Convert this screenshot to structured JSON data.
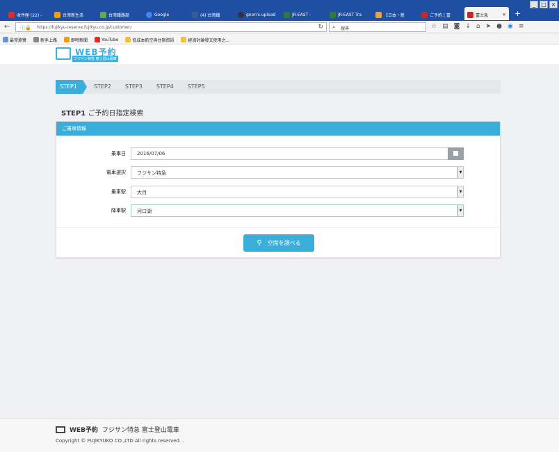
{
  "browser": {
    "tabs": [
      {
        "label": "收件匣 (22) -",
        "color": "#d93025"
      },
      {
        "label": "台灣新生活",
        "color": "#f39c12"
      },
      {
        "label": "台灣鐵路部",
        "color": "#6aa84f"
      },
      {
        "label": "Google",
        "color": "#4285f4"
      },
      {
        "label": "(4) 台灣鐵",
        "color": "#3b5998"
      },
      {
        "label": "gnon's upload",
        "color": "#333333"
      },
      {
        "label": "JR-EAST -",
        "color": "#2e7d32"
      },
      {
        "label": "JR-EAST Tra",
        "color": "#2e7d32"
      },
      {
        "label": "【日本・新",
        "color": "#e6a23c"
      },
      {
        "label": "ご予約 | 富",
        "color": "#c62828"
      },
      {
        "label": "富士急",
        "color": "#c62828"
      }
    ],
    "new_tab": "+",
    "url": "https://fujikyu-reserve.fujikyu.co.jp/customer/",
    "search_placeholder": "搜尋",
    "bookmarks": [
      {
        "label": "最常瀏覽",
        "color": "#6b8fd6"
      },
      {
        "label": "新手上路",
        "color": "#888888"
      },
      {
        "label": "即時新聞",
        "color": "#f39c12"
      },
      {
        "label": "YouTube",
        "color": "#e52d27"
      },
      {
        "label": "低成本航空與住宿資訊",
        "color": "#f1c232"
      },
      {
        "label": "經濟討論發文使用之...",
        "color": "#f1c232"
      }
    ]
  },
  "site": {
    "logo_word": "WEB予約",
    "logo_sub": "フジサン特急 富士登山電車"
  },
  "steps": [
    "STEP1",
    "STEP2",
    "STEP3",
    "STEP4",
    "STEP5"
  ],
  "page_title": {
    "step": "STEP1",
    "text": "ご予約日指定検索"
  },
  "card": {
    "header": "ご乗車情報",
    "fields": [
      {
        "label": "乗車日",
        "value": "2016/07/06"
      },
      {
        "label": "電車選択",
        "value": "フジサン特急"
      },
      {
        "label": "乗車駅",
        "value": "大月"
      },
      {
        "label": "降車駅",
        "value": "河口湖"
      }
    ],
    "search_button": "空席を調べる"
  },
  "footer": {
    "logo_word": "WEB予約",
    "logo_text": "フジサン特急 富士登山電車",
    "copyright": "Copyright © FUJIKYUKO CO.,LTD All rights reserved. ."
  }
}
